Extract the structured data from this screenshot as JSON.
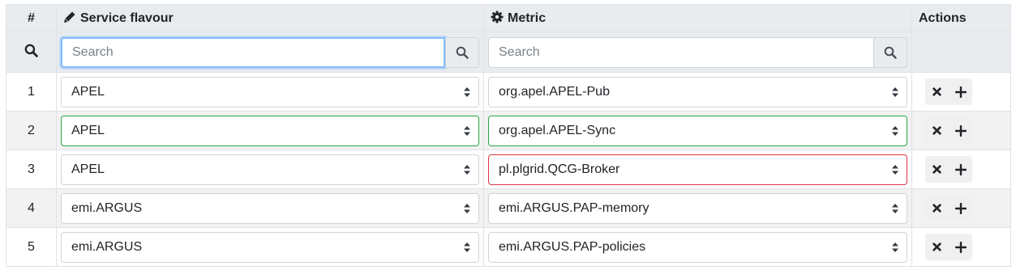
{
  "columns": {
    "num": "#",
    "service_flavour": "Service flavour",
    "metric": "Metric",
    "actions": "Actions"
  },
  "filters": {
    "service_flavour_placeholder": "Search",
    "metric_placeholder": "Search"
  },
  "rows": [
    {
      "num": "1",
      "service_flavour": "APEL",
      "metric": "org.apel.APEL-Pub"
    },
    {
      "num": "2",
      "service_flavour": "APEL",
      "metric": "org.apel.APEL-Sync"
    },
    {
      "num": "3",
      "service_flavour": "APEL",
      "metric": "pl.plgrid.QCG-Broker"
    },
    {
      "num": "4",
      "service_flavour": "emi.ARGUS",
      "metric": "emi.ARGUS.PAP-memory"
    },
    {
      "num": "5",
      "service_flavour": "emi.ARGUS",
      "metric": "emi.ARGUS.PAP-policies"
    }
  ],
  "colors": {
    "valid_border": "#28a745",
    "invalid_border": "#dc3545",
    "focus_border": "#80bdff"
  }
}
